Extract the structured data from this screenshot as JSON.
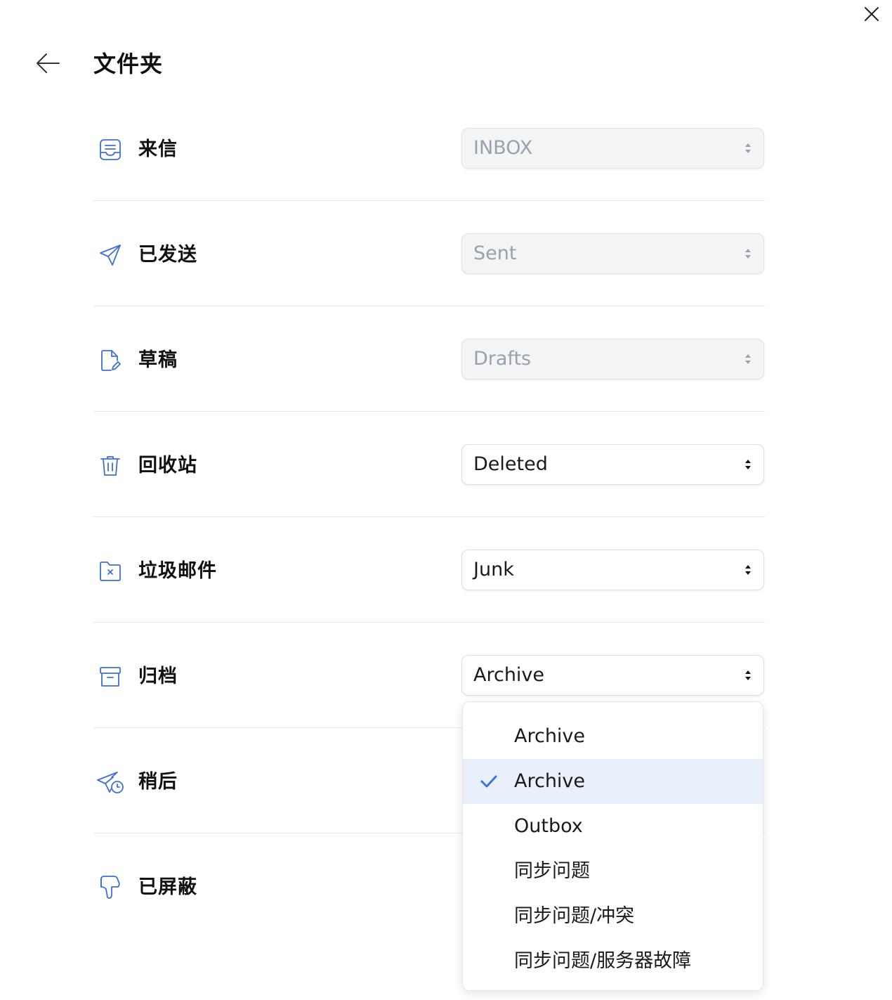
{
  "header": {
    "title": "文件夹"
  },
  "folders": [
    {
      "label": "来信",
      "icon": "inbox-icon",
      "value": "INBOX",
      "disabled": true
    },
    {
      "label": "已发送",
      "icon": "send-icon",
      "value": "Sent",
      "disabled": true
    },
    {
      "label": "草稿",
      "icon": "draft-icon",
      "value": "Drafts",
      "disabled": true
    },
    {
      "label": "回收站",
      "icon": "trash-icon",
      "value": "Deleted",
      "disabled": false
    },
    {
      "label": "垃圾邮件",
      "icon": "junk-folder-icon",
      "value": "Junk",
      "disabled": false
    },
    {
      "label": "归档",
      "icon": "archive-icon",
      "value": "Archive",
      "disabled": false
    },
    {
      "label": "稍后",
      "icon": "send-later-icon",
      "value": "",
      "disabled": false
    },
    {
      "label": "已屏蔽",
      "icon": "thumbs-down-icon",
      "value": "",
      "disabled": false
    }
  ],
  "dropdown": {
    "items": [
      {
        "label": "Archive",
        "selected": false
      },
      {
        "label": "Archive",
        "selected": true
      },
      {
        "label": "Outbox",
        "selected": false
      },
      {
        "label": "同步问题",
        "selected": false
      },
      {
        "label": "同步问题/冲突",
        "selected": false
      },
      {
        "label": "同步问题/服务器故障",
        "selected": false
      }
    ]
  },
  "colors": {
    "accent": "#3b73e0",
    "icon": "#3f6fd6",
    "selected_bg": "#e9f0fc",
    "disabled_bg": "#f3f4f6",
    "disabled_text": "#9aa1ab"
  }
}
